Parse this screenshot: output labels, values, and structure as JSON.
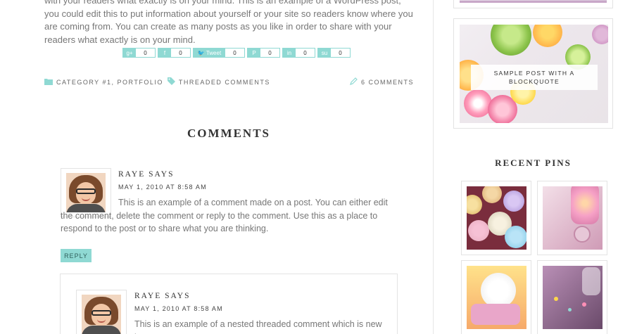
{
  "post": {
    "intro_text": "with your readers what exactly is on your mind. This is an example of a WordPress post, you could edit this to put information about yourself or your site so readers know where you are coming from. You can create as many posts as you like in order to share with your readers what exactly is on your mind."
  },
  "share": {
    "googleplus": {
      "icon": "g+",
      "count": "0"
    },
    "facebook": {
      "icon": "f",
      "count": "0"
    },
    "twitter": {
      "icon": "🐦 Tweet",
      "count": "0"
    },
    "pinterest": {
      "icon": "P",
      "count": "0"
    },
    "linkedin": {
      "icon": "in",
      "count": "0"
    },
    "stumbleupon": {
      "icon": "su",
      "count": "0"
    }
  },
  "meta": {
    "categories": "CATEGORY #1, PORTFOLIO",
    "tags": "THREADED COMMENTS",
    "comments_count": "6 COMMENTS"
  },
  "comments": {
    "title": "COMMENTS",
    "items": [
      {
        "author": "RAYE SAYS",
        "date": "MAY 1, 2010 AT 8:58 AM",
        "text": "This is an example of a comment made on a post. You can either edit the comment, delete the comment or reply to the comment. Use this as a place to respond to the post or to share what you are thinking.",
        "reply_label": "REPLY"
      },
      {
        "author": "RAYE SAYS",
        "date": "MAY 1, 2010 AT 8:58 AM",
        "text": "This is an example of a nested threaded comment which is new in"
      }
    ]
  },
  "sidebar": {
    "featured_caption": "SAMPLE POST WITH A BLOCKQUOTE",
    "recent_pins_title": "RECENT PINS"
  },
  "colors": {
    "accent": "#8fd9d3",
    "text": "#777777",
    "heading": "#333333"
  }
}
